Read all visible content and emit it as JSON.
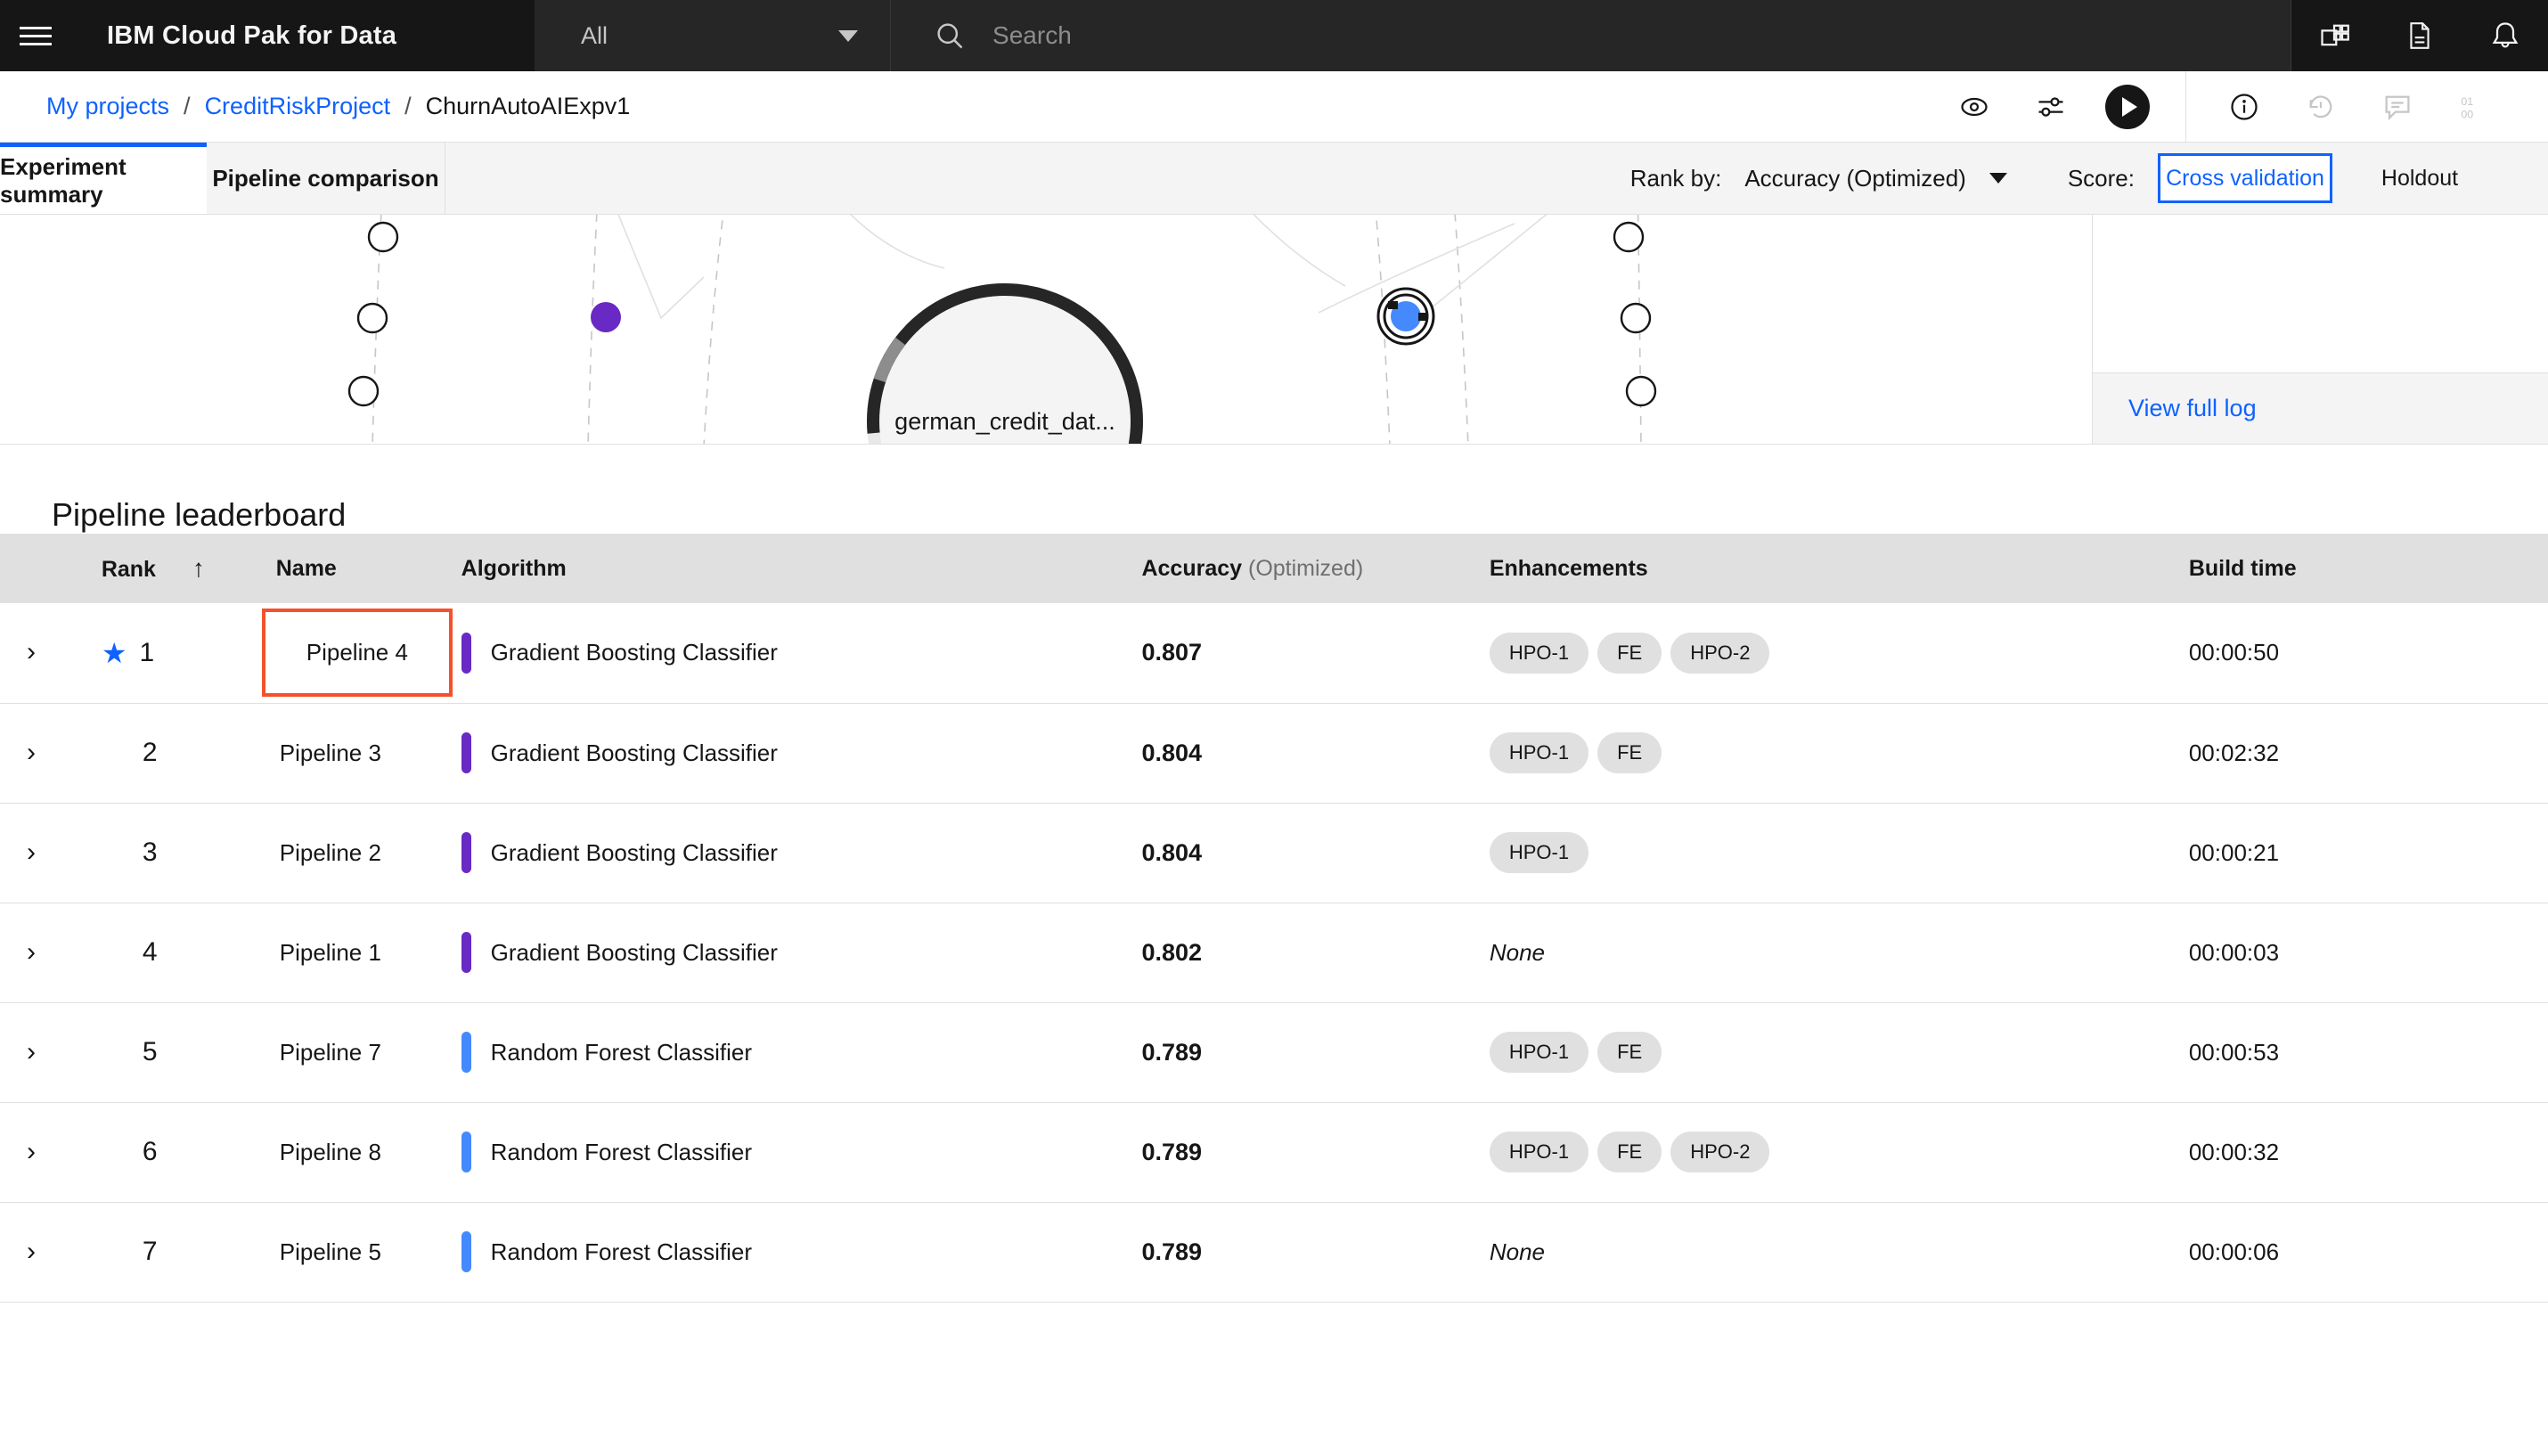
{
  "header": {
    "menu_icon": "hamburger-menu-icon",
    "title": "IBM Cloud Pak for Data",
    "scope": {
      "value": "All",
      "icon": "chevron-down-icon"
    },
    "search": {
      "value": "",
      "placeholder": "Search",
      "icon": "search-icon"
    },
    "icons": [
      "app-switcher-icon",
      "document-icon",
      "notification-bell-icon"
    ]
  },
  "breadcrumb": {
    "items": [
      {
        "label": "My projects",
        "link": true
      },
      {
        "label": "CreditRiskProject",
        "link": true
      },
      {
        "label": "ChurnAutoAIExpv1",
        "link": false
      }
    ],
    "separator": "/",
    "actions": [
      "view-eye-icon",
      "settings-sliders-icon",
      "run-play-icon",
      "info-icon",
      "history-icon",
      "comments-icon",
      "code-binary-icon"
    ]
  },
  "tabs": [
    {
      "label": "Experiment summary",
      "active": true
    },
    {
      "label": "Pipeline comparison",
      "active": false
    }
  ],
  "controls": {
    "rank_by_label": "Rank by:",
    "rank_by_value": "Accuracy (Optimized)",
    "score_label": "Score:",
    "score_options": [
      {
        "label": "Cross validation",
        "selected": true
      },
      {
        "label": "Holdout",
        "selected": false
      }
    ]
  },
  "visualization": {
    "center_label": "german_credit_dat...",
    "node_colors": {
      "purple": "#6929c4",
      "blue": "#4589ff",
      "ring": "#262626"
    }
  },
  "log_panel": {
    "view_full_log": "View full log"
  },
  "leaderboard": {
    "title": "Pipeline leaderboard",
    "columns": {
      "expand": "",
      "rank": "Rank",
      "sort_icon": "sort-ascending-icon",
      "name": "Name",
      "algorithm": "Algorithm",
      "accuracy": "Accuracy",
      "accuracy_sub": "(Optimized)",
      "enhancements": "Enhancements",
      "build_time": "Build time"
    },
    "rows": [
      {
        "rank": "1",
        "starred": true,
        "highlighted": true,
        "name": "Pipeline 4",
        "algorithm": "Gradient Boosting Classifier",
        "algorithm_color": "#6929c4",
        "accuracy": "0.807",
        "enhancements": [
          "HPO-1",
          "FE",
          "HPO-2"
        ],
        "build_time": "00:00:50"
      },
      {
        "rank": "2",
        "starred": false,
        "highlighted": false,
        "name": "Pipeline 3",
        "algorithm": "Gradient Boosting Classifier",
        "algorithm_color": "#6929c4",
        "accuracy": "0.804",
        "enhancements": [
          "HPO-1",
          "FE"
        ],
        "build_time": "00:02:32"
      },
      {
        "rank": "3",
        "starred": false,
        "highlighted": false,
        "name": "Pipeline 2",
        "algorithm": "Gradient Boosting Classifier",
        "algorithm_color": "#6929c4",
        "accuracy": "0.804",
        "enhancements": [
          "HPO-1"
        ],
        "build_time": "00:00:21"
      },
      {
        "rank": "4",
        "starred": false,
        "highlighted": false,
        "name": "Pipeline 1",
        "algorithm": "Gradient Boosting Classifier",
        "algorithm_color": "#6929c4",
        "accuracy": "0.802",
        "enhancements": [],
        "enhancements_none": "None",
        "build_time": "00:00:03"
      },
      {
        "rank": "5",
        "starred": false,
        "highlighted": false,
        "name": "Pipeline 7",
        "algorithm": "Random Forest Classifier",
        "algorithm_color": "#4589ff",
        "accuracy": "0.789",
        "enhancements": [
          "HPO-1",
          "FE"
        ],
        "build_time": "00:00:53"
      },
      {
        "rank": "6",
        "starred": false,
        "highlighted": false,
        "name": "Pipeline 8",
        "algorithm": "Random Forest Classifier",
        "algorithm_color": "#4589ff",
        "accuracy": "0.789",
        "enhancements": [
          "HPO-1",
          "FE",
          "HPO-2"
        ],
        "build_time": "00:00:32"
      },
      {
        "rank": "7",
        "starred": false,
        "highlighted": false,
        "name": "Pipeline 5",
        "algorithm": "Random Forest Classifier",
        "algorithm_color": "#4589ff",
        "accuracy": "0.789",
        "enhancements": [],
        "enhancements_none": "None",
        "build_time": "00:00:06"
      }
    ]
  }
}
